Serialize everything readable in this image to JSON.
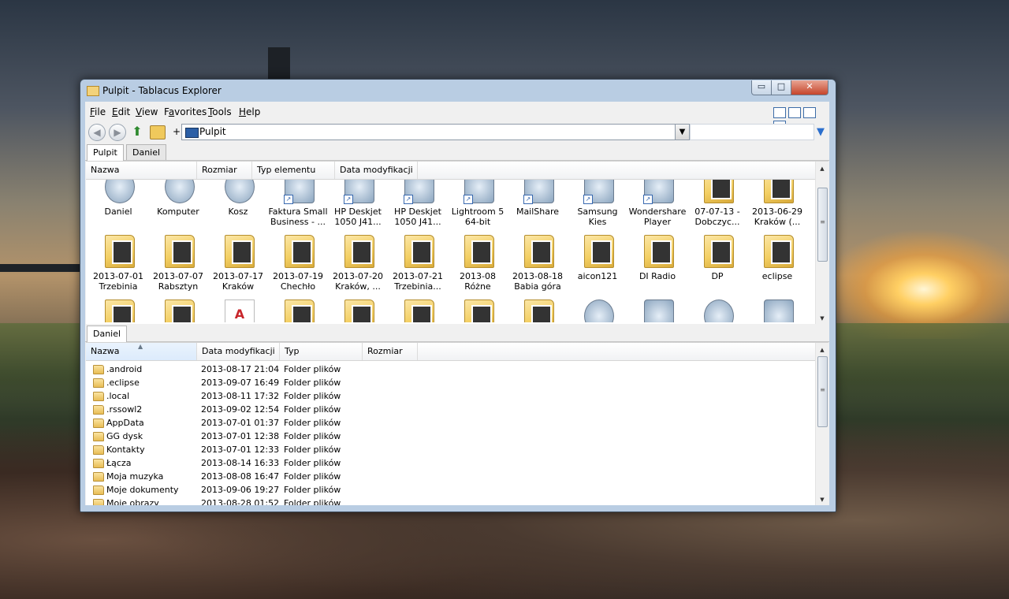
{
  "window": {
    "title": "Pulpit - Tablacus Explorer",
    "buttons": {
      "minimize": "▭",
      "maximize": "□",
      "close": "✕"
    }
  },
  "menu": [
    {
      "underline": "F",
      "rest": "ile"
    },
    {
      "underline": "E",
      "rest": "dit"
    },
    {
      "underline": "V",
      "rest": "iew"
    },
    {
      "pre": "F",
      "underline": "a",
      "rest": "vorites"
    },
    {
      "underline": "T",
      "rest": "ools"
    },
    {
      "underline": "H",
      "rest": "elp"
    }
  ],
  "toolbar": {
    "back_icon": "back-arrow-icon",
    "forward_icon": "forward-arrow-icon",
    "up_icon": "up-arrow-icon",
    "plus": "+",
    "address": "Pulpit",
    "search_placeholder": ""
  },
  "top_tabs": [
    "Pulpit",
    "Daniel"
  ],
  "top_pane": {
    "headers": [
      "Nazwa",
      "Rozmiar",
      "Typ elementu",
      "Data modyfikacji"
    ],
    "items": [
      {
        "label": "Daniel",
        "kind": "round"
      },
      {
        "label": "Komputer",
        "kind": "round"
      },
      {
        "label": "Kosz",
        "kind": "round"
      },
      {
        "label": "Faktura Small Business - ...",
        "kind": "app"
      },
      {
        "label": "HP Deskjet 1050 J41...",
        "kind": "app"
      },
      {
        "label": "HP Deskjet 1050 J41...",
        "kind": "app"
      },
      {
        "label": "Lightroom 5 64-bit",
        "kind": "app"
      },
      {
        "label": "MailShare",
        "kind": "app"
      },
      {
        "label": "Samsung Kies",
        "kind": "app"
      },
      {
        "label": "Wondershare Player",
        "kind": "app"
      },
      {
        "label": "07-07-13 - Dobczyc...",
        "kind": "folder"
      },
      {
        "label": "2013-06-29 Kraków (...",
        "kind": "folder"
      },
      {
        "label": "2013-07-01 Trzebinia",
        "kind": "folder"
      },
      {
        "label": "2013-07-07 Rabsztyn",
        "kind": "folder"
      },
      {
        "label": "2013-07-17 Kraków",
        "kind": "folder"
      },
      {
        "label": "2013-07-19 Chechło",
        "kind": "folder"
      },
      {
        "label": "2013-07-20 Kraków, ...",
        "kind": "folder"
      },
      {
        "label": "2013-07-21 Trzebinia...",
        "kind": "folder"
      },
      {
        "label": "2013-08 Różne",
        "kind": "folder"
      },
      {
        "label": "2013-08-18 Babia góra",
        "kind": "folder"
      },
      {
        "label": "aicon121",
        "kind": "folder"
      },
      {
        "label": "DI Radio",
        "kind": "folder"
      },
      {
        "label": "DP",
        "kind": "folder"
      },
      {
        "label": "eclipse",
        "kind": "folder"
      },
      {
        "label": "",
        "kind": "folder"
      },
      {
        "label": "",
        "kind": "folder"
      },
      {
        "label": "",
        "kind": "pdf"
      },
      {
        "label": "",
        "kind": "folder"
      },
      {
        "label": "",
        "kind": "folder"
      },
      {
        "label": "",
        "kind": "folder"
      },
      {
        "label": "",
        "kind": "folder"
      },
      {
        "label": "",
        "kind": "folder"
      },
      {
        "label": "",
        "kind": "round"
      },
      {
        "label": "",
        "kind": "app"
      },
      {
        "label": "",
        "kind": "round"
      },
      {
        "label": "",
        "kind": "app"
      },
      {
        "label": "",
        "kind": "sun"
      }
    ]
  },
  "bottom_tabs": [
    "Daniel"
  ],
  "bottom_pane": {
    "headers": [
      "Nazwa",
      "Data modyfikacji",
      "Typ",
      "Rozmiar"
    ],
    "rows": [
      {
        "name": ".android",
        "date": "2013-08-17 21:04",
        "type": "Folder plików",
        "size": ""
      },
      {
        "name": ".eclipse",
        "date": "2013-09-07 16:49",
        "type": "Folder plików",
        "size": ""
      },
      {
        "name": ".local",
        "date": "2013-08-11 17:32",
        "type": "Folder plików",
        "size": ""
      },
      {
        "name": ".rssowl2",
        "date": "2013-09-02 12:54",
        "type": "Folder plików",
        "size": ""
      },
      {
        "name": "AppData",
        "date": "2013-07-01 01:37",
        "type": "Folder plików",
        "size": ""
      },
      {
        "name": "GG dysk",
        "date": "2013-07-01 12:38",
        "type": "Folder plików",
        "size": ""
      },
      {
        "name": "Kontakty",
        "date": "2013-07-01 12:33",
        "type": "Folder plików",
        "size": ""
      },
      {
        "name": "Łącza",
        "date": "2013-08-14 16:33",
        "type": "Folder plików",
        "size": ""
      },
      {
        "name": "Moja muzyka",
        "date": "2013-08-08 16:47",
        "type": "Folder plików",
        "size": ""
      },
      {
        "name": "Moje dokumenty",
        "date": "2013-09-06 19:27",
        "type": "Folder plików",
        "size": ""
      },
      {
        "name": "Moje obrazy",
        "date": "2013-08-28 01:52",
        "type": "Folder plików",
        "size": ""
      }
    ]
  }
}
